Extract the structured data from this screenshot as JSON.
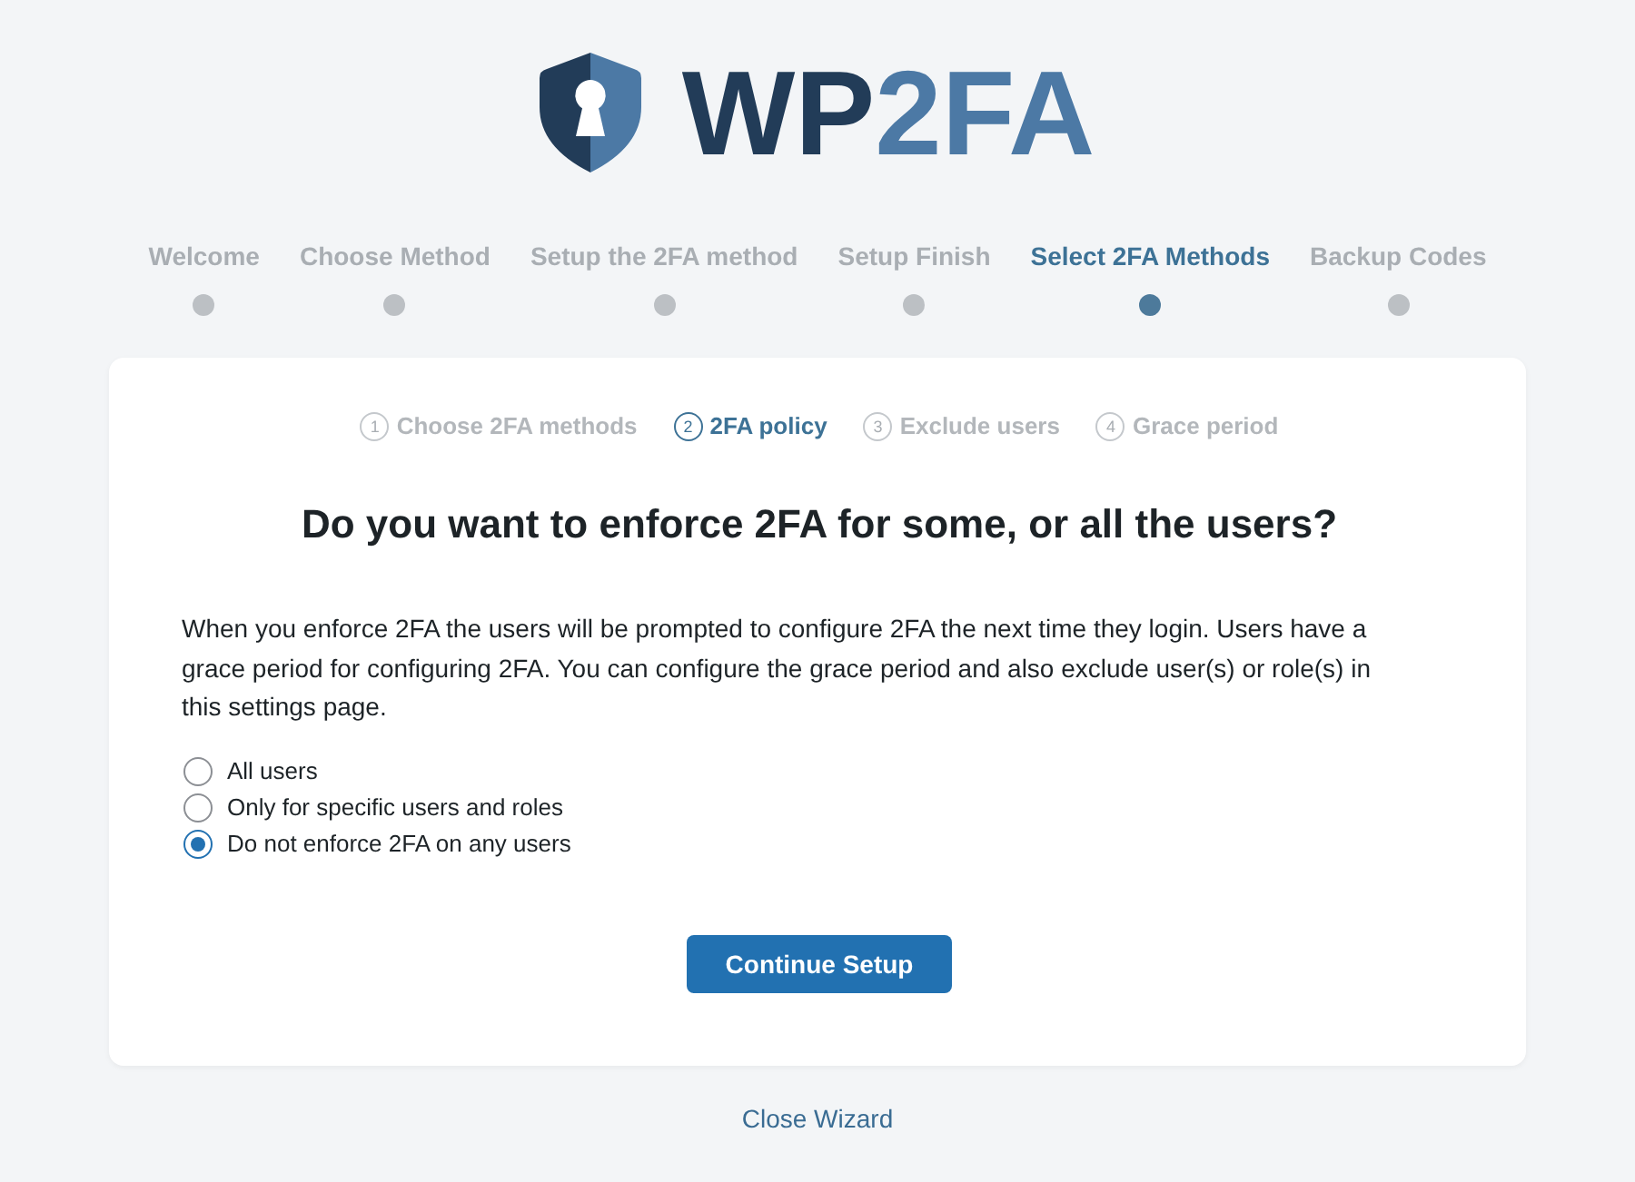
{
  "logo": {
    "text_primary": "WP",
    "text_secondary": "2FA"
  },
  "steps": [
    {
      "label": "Welcome",
      "selected": false
    },
    {
      "label": "Choose Method",
      "selected": false
    },
    {
      "label": "Setup the 2FA method",
      "selected": false
    },
    {
      "label": "Setup Finish",
      "selected": false
    },
    {
      "label": "Select 2FA Methods",
      "selected": true
    },
    {
      "label": "Backup Codes",
      "selected": false
    }
  ],
  "card": {
    "substeps": [
      {
        "number": "1",
        "label": "Choose 2FA methods",
        "selected": false
      },
      {
        "number": "2",
        "label": "2FA policy",
        "selected": true
      },
      {
        "number": "3",
        "label": "Exclude users",
        "selected": false
      },
      {
        "number": "4",
        "label": "Grace period",
        "selected": false
      }
    ],
    "heading": "Do you want to enforce 2FA for some, or all the users?",
    "description": "When you enforce 2FA the users will be prompted to configure 2FA the next time they login. Users have a grace period for configuring 2FA. You can configure the grace period and also exclude user(s) or role(s) in this settings page.",
    "options": [
      {
        "label": "All users",
        "selected": false
      },
      {
        "label": "Only for specific users and roles",
        "selected": false
      },
      {
        "label": "Do not enforce 2FA on any users",
        "selected": true
      }
    ],
    "button": "Continue Setup"
  },
  "close_link": "Close Wizard"
}
